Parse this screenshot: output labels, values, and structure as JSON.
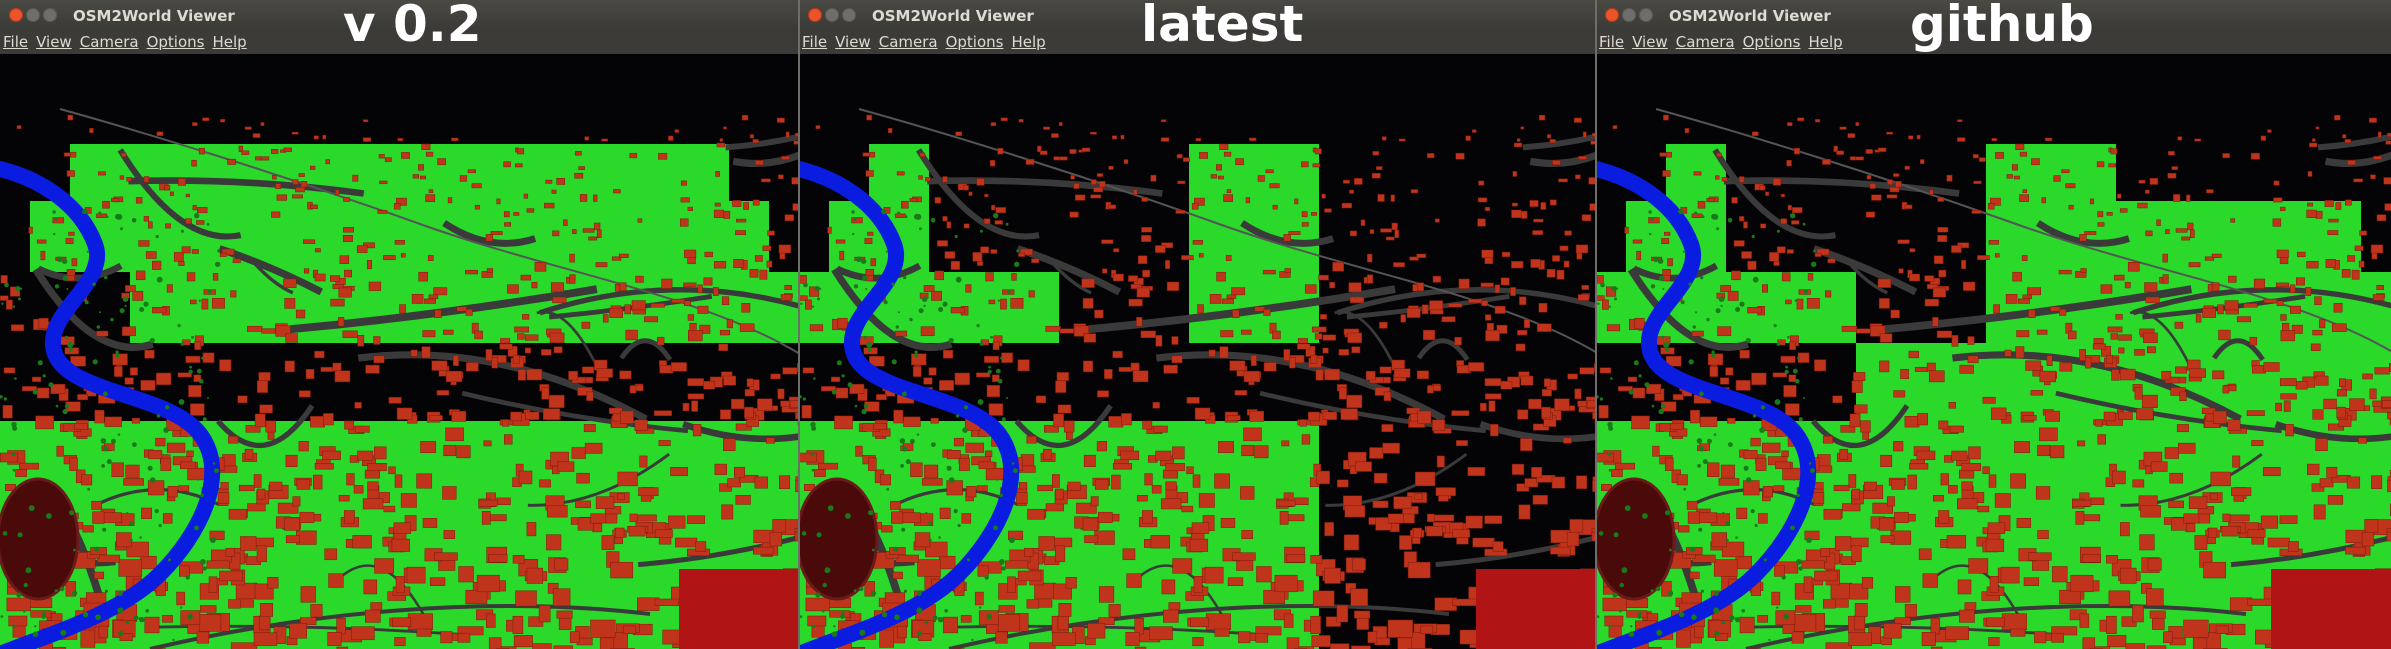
{
  "colors": {
    "background": "#040407",
    "grass": "#2bd92b",
    "river": "#0a1ce0",
    "roof": "#c0341c",
    "road": "#3a3a3a"
  },
  "windows": [
    {
      "title": "OSM2World Viewer",
      "overlay_label": "v 0.2",
      "menu": [
        "File",
        "View",
        "Camera",
        "Options",
        "Help"
      ],
      "green_tiles": [
        [
          0,
          1
        ],
        [
          1,
          1
        ],
        [
          2,
          1
        ],
        [
          3,
          1
        ],
        [
          4,
          1
        ],
        [
          5,
          1
        ],
        [
          0,
          2
        ],
        [
          1,
          2
        ],
        [
          2,
          2
        ],
        [
          3,
          2
        ],
        [
          4,
          2
        ],
        [
          5,
          2
        ],
        [
          1,
          3
        ],
        [
          2,
          3
        ],
        [
          3,
          3
        ],
        [
          4,
          3
        ],
        [
          5,
          3
        ],
        [
          0,
          5
        ],
        [
          1,
          5
        ],
        [
          2,
          5
        ],
        [
          3,
          5
        ],
        [
          4,
          5
        ],
        [
          5,
          5
        ]
      ]
    },
    {
      "title": "OSM2World Viewer",
      "overlay_label": "latest",
      "menu": [
        "File",
        "View",
        "Camera",
        "Options",
        "Help"
      ],
      "green_tiles": [
        [
          0,
          1
        ],
        [
          0,
          2
        ],
        [
          3,
          1
        ],
        [
          3,
          2
        ],
        [
          0,
          3
        ],
        [
          1,
          3
        ],
        [
          3,
          3
        ],
        [
          0,
          5
        ],
        [
          1,
          5
        ],
        [
          2,
          5
        ],
        [
          3,
          5
        ]
      ]
    },
    {
      "title": "OSM2World Viewer",
      "overlay_label": "github",
      "menu": [
        "File",
        "View",
        "Camera",
        "Options",
        "Help"
      ],
      "green_tiles": [
        [
          0,
          1
        ],
        [
          0,
          2
        ],
        [
          3,
          1
        ],
        [
          3,
          2
        ],
        [
          4,
          2
        ],
        [
          5,
          2
        ],
        [
          0,
          3
        ],
        [
          1,
          3
        ],
        [
          3,
          3
        ],
        [
          4,
          3
        ],
        [
          5,
          3
        ],
        [
          2,
          4
        ],
        [
          3,
          4
        ],
        [
          4,
          4
        ],
        [
          5,
          4
        ],
        [
          0,
          5
        ],
        [
          1,
          5
        ],
        [
          2,
          5
        ],
        [
          3,
          5
        ],
        [
          4,
          5
        ],
        [
          5,
          5
        ]
      ]
    }
  ]
}
